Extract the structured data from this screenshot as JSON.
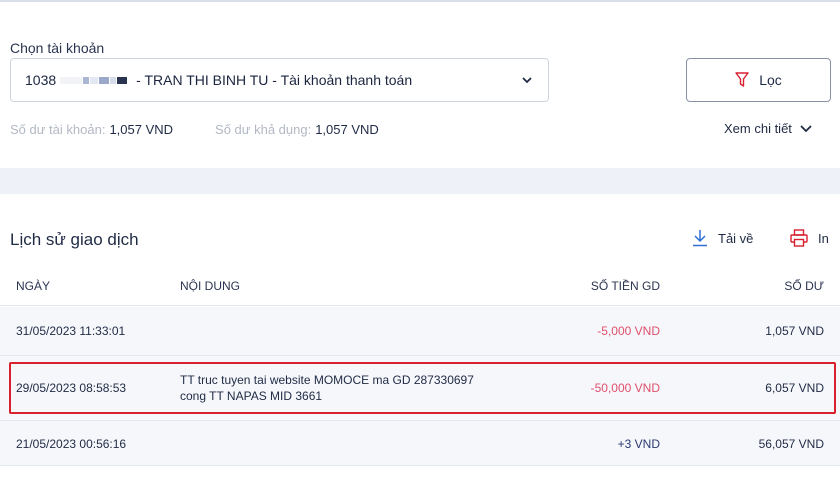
{
  "account": {
    "label": "Chọn tài khoản",
    "number_prefix": "1038",
    "name_suffix": "- TRAN THI BINH TU - Tài khoản thanh toán"
  },
  "filter": {
    "label": "Lọc",
    "icon": "filter-icon"
  },
  "balances": {
    "account_label": "Số dư tài khoản:",
    "account_value": "1,057 VND",
    "available_label": "Số dư khả dụng:",
    "available_value": "1,057 VND"
  },
  "detail_link": {
    "label": "Xem chi tiết",
    "icon": "chevron-down-icon"
  },
  "history": {
    "title": "Lịch sử giao dịch",
    "download_label": "Tải về",
    "print_label": "In"
  },
  "table": {
    "headers": {
      "date": "NGÀY",
      "content": "NỘI DUNG",
      "amount": "SỐ TIỀN GD",
      "balance": "SỐ DƯ"
    },
    "rows": [
      {
        "date": "31/05/2023 11:33:01",
        "content1": "",
        "content2": "",
        "amount": "-5,000 VND",
        "balance": "1,057 VND"
      },
      {
        "date": "29/05/2023 08:58:53",
        "content1": "TT truc tuyen tai website MOMOCE ma GD 287330697",
        "content2": "cong TT NAPAS MID 3661",
        "amount": "-50,000 VND",
        "balance": "6,057 VND"
      },
      {
        "date": "21/05/2023 00:56:16",
        "content1": "",
        "content2": "",
        "amount": "+3 VND",
        "balance": "56,057 VND"
      }
    ]
  },
  "colors": {
    "negative": "#e0506b",
    "positive": "#2b3a70",
    "highlight": "#d8202f",
    "accent_icon": "#2f6fd6",
    "print_icon": "#d8202f"
  }
}
